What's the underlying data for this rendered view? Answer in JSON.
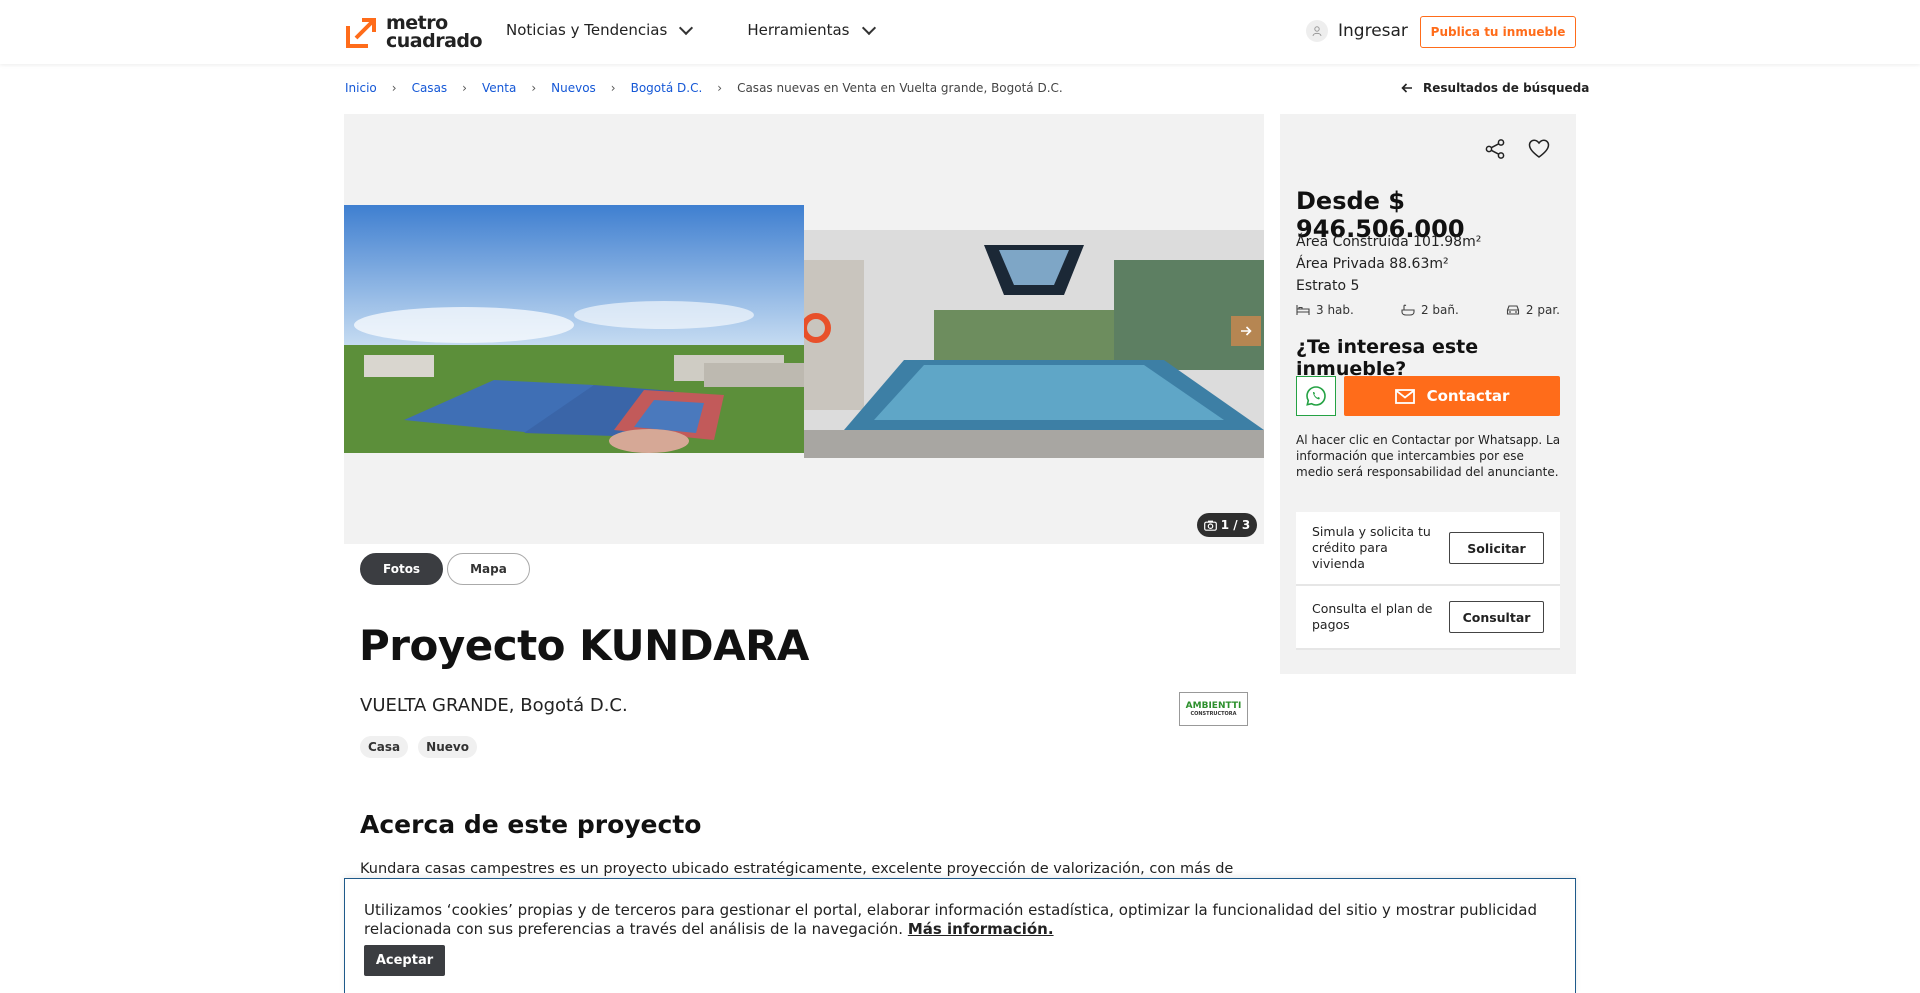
{
  "header": {
    "logo_line1": "metro",
    "logo_line2": "cuadrado",
    "nav": [
      {
        "label": "Noticias y Tendencias"
      },
      {
        "label": "Herramientas"
      }
    ],
    "login_label": "Ingresar",
    "publish_label": "Publica tu inmueble",
    "brand_color": "#ff6c1a"
  },
  "breadcrumb": {
    "items": [
      "Inicio",
      "Casas",
      "Venta",
      "Nuevos",
      "Bogotá D.C."
    ],
    "separator": "›",
    "current": "Casas nuevas en Venta en Vuelta grande, Bogotá D.C.",
    "back_label": "Resultados de búsqueda"
  },
  "gallery": {
    "counter": "1 / 3",
    "tabs": [
      "Fotos",
      "Mapa"
    ],
    "active_tab": "Fotos"
  },
  "listing": {
    "title": "Proyecto KUNDARA",
    "location": "VUELTA GRANDE, Bogotá D.C.",
    "tags": [
      "Casa",
      "Nuevo"
    ],
    "builder_logo_text": "AMBIENTTI",
    "builder_logo_sub": "CONSTRUCTORA",
    "about_title": "Acerca de este proyecto",
    "about_text": "Kundara casas campestres es un proyecto ubicado estratégicamente, excelente proyección de valorización, con más de"
  },
  "side": {
    "price": "Desde $ 946.506.000",
    "area_built": "Área Construida 101.98m²",
    "area_private": "Área Privada 88.63m²",
    "estrato": "Estrato 5",
    "rooms": "3 hab.",
    "baths": "2 bañ.",
    "parking": "2 par.",
    "interest_title": "¿Te interesa este inmueble?",
    "contact_label": "Contactar",
    "disclaimer": "Al hacer clic en Contactar por Whatsapp. La información que intercambies por ese medio será responsabilidad del anunciante.",
    "credit_text": "Simula y solicita tu crédito para vivienda",
    "credit_btn": "Solicitar",
    "plan_text": "Consulta el plan de pagos",
    "plan_btn": "Consultar"
  },
  "cookie": {
    "text": "Utilizamos ‘cookies’ propias y de terceros para gestionar el portal, elaborar información estadística, optimizar la funcionalidad del sitio y mostrar publicidad relacionada con sus preferencias a través del análisis de la navegación.",
    "link": "Más información.",
    "accept": "Aceptar"
  }
}
